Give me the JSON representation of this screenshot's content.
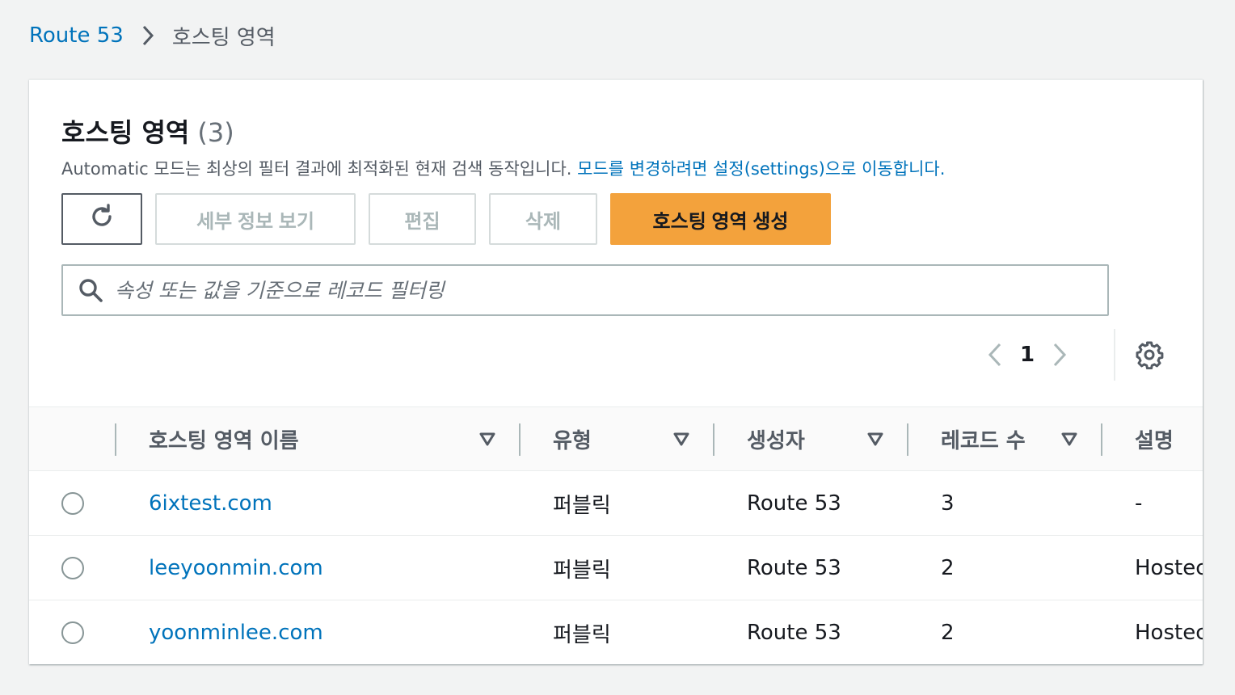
{
  "breadcrumb": {
    "root": "Route 53",
    "current": "호스팅 영역"
  },
  "header": {
    "title": "호스팅 영역",
    "count": "(3)",
    "description": "Automatic 모드는 최상의 필터 결과에 최적화된 현재 검색 동작입니다.",
    "settings_link": "모드를 변경하려면 설정(settings)으로 이동합니다."
  },
  "toolbar": {
    "refresh_icon": "refresh-icon",
    "details_label": "세부 정보 보기",
    "edit_label": "편집",
    "delete_label": "삭제",
    "create_label": "호스팅 영역 생성"
  },
  "search": {
    "placeholder": "속성 또는 값을 기준으로 레코드 필터링"
  },
  "pagination": {
    "current_page": "1"
  },
  "table": {
    "columns": [
      "호스팅 영역 이름",
      "유형",
      "생성자",
      "레코드 수",
      "설명"
    ],
    "rows": [
      {
        "name": "6ixtest.com",
        "type": "퍼블릭",
        "created_by": "Route 53",
        "record_count": "3",
        "description": "-"
      },
      {
        "name": "leeyoonmin.com",
        "type": "퍼블릭",
        "created_by": "Route 53",
        "record_count": "2",
        "description": "Hostec"
      },
      {
        "name": "yoonminlee.com",
        "type": "퍼블릭",
        "created_by": "Route 53",
        "record_count": "2",
        "description": "Hostec"
      }
    ]
  },
  "colors": {
    "link": "#0073bb",
    "primary_button": "#f3a23c",
    "background": "#f2f3f3"
  }
}
